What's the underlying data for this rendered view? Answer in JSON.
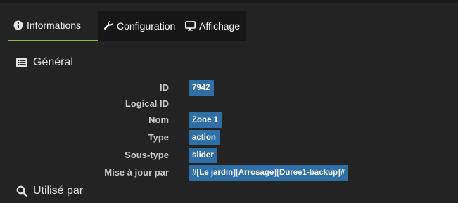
{
  "tabs": [
    {
      "label": "Informations",
      "icon": "info-circle-icon",
      "active": true
    },
    {
      "label": "Configuration",
      "icon": "wrench-icon",
      "active": false
    },
    {
      "label": "Affichage",
      "icon": "monitor-icon",
      "active": false
    }
  ],
  "general": {
    "title": "Général",
    "icon": "list-icon",
    "rows": [
      {
        "label": "ID",
        "value": "7942"
      },
      {
        "label": "Logical ID",
        "value": ""
      },
      {
        "label": "Nom",
        "value": "Zone 1"
      },
      {
        "label": "Type",
        "value": "action"
      },
      {
        "label": "Sous-type",
        "value": "slider"
      },
      {
        "label": "Mise à jour par",
        "value": "#[Le jardin][Arrosage][Duree1-backup]#"
      }
    ]
  },
  "used_by": {
    "title": "Utilisé par",
    "icon": "search-icon"
  },
  "colors": {
    "accent": "#8bc34a",
    "value_bg": "#2f6fa6",
    "background": "#232323"
  }
}
